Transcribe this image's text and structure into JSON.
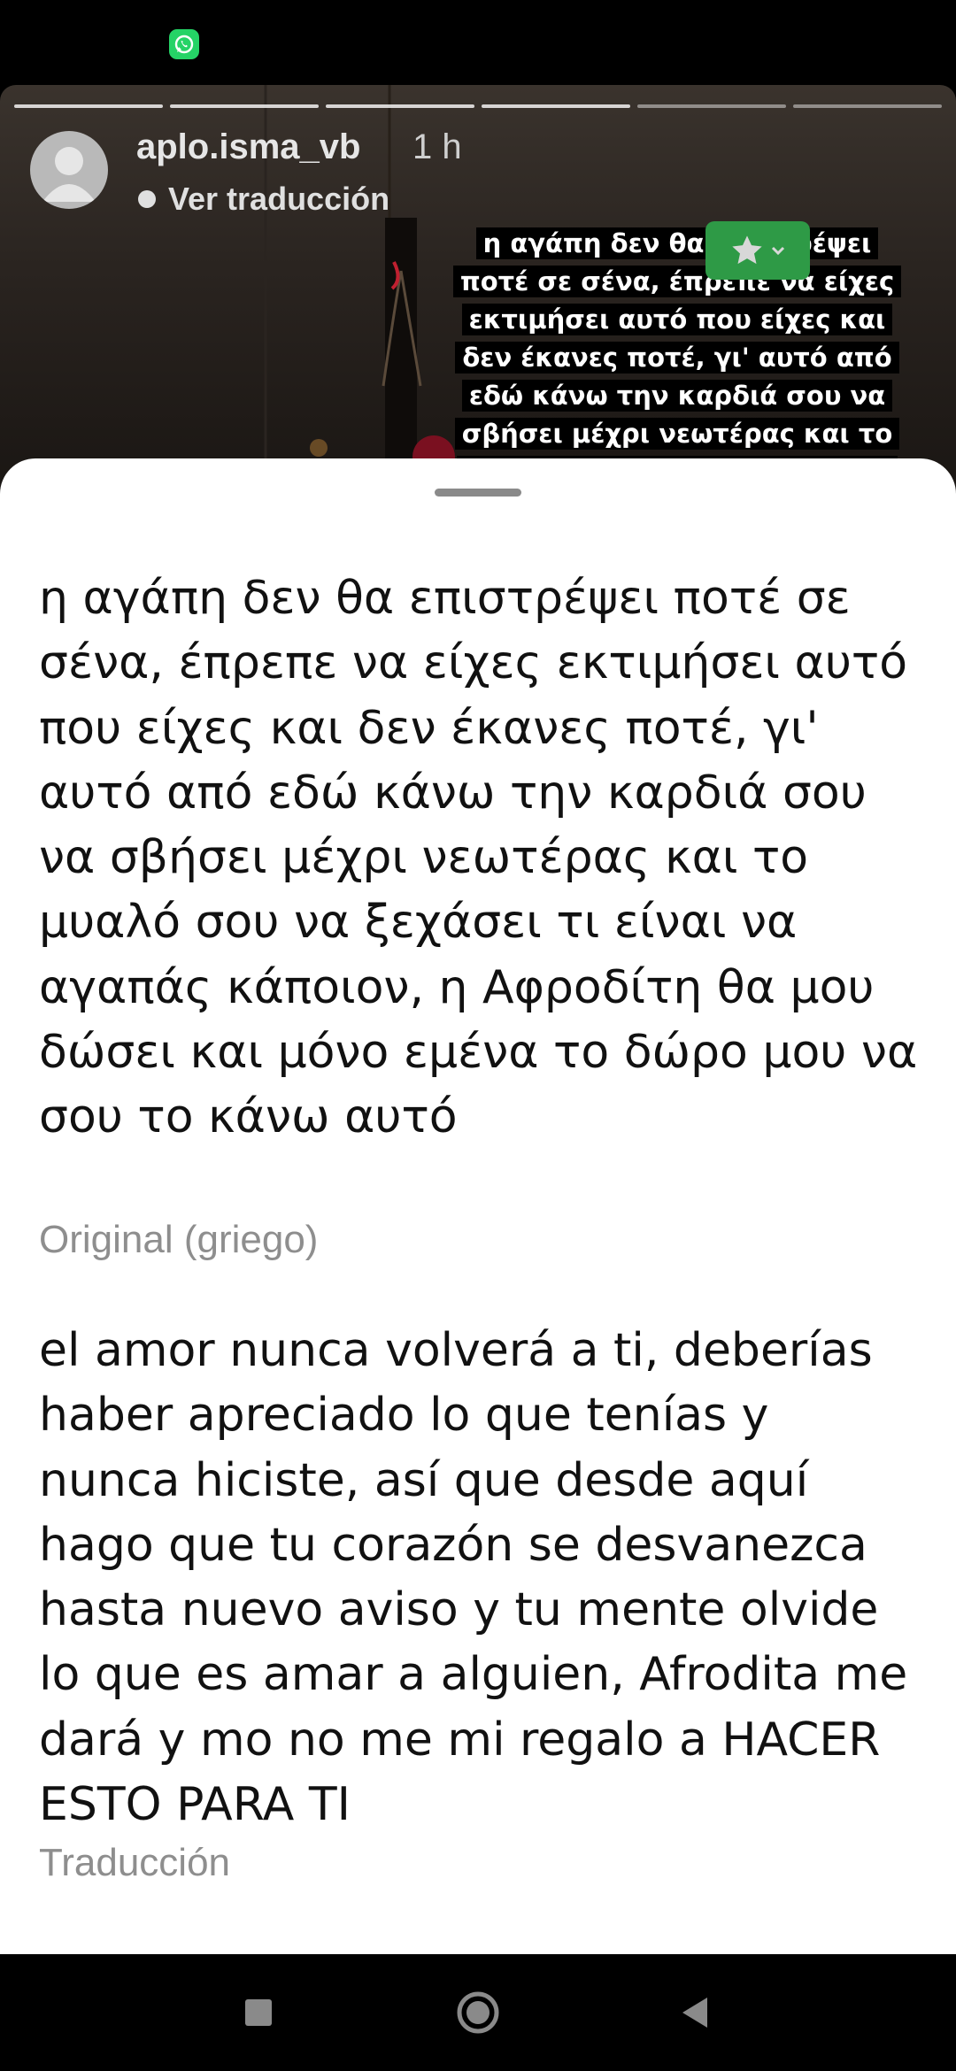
{
  "status_bar": {
    "notification_icon": "whatsapp-icon"
  },
  "story": {
    "username": "aplo.isma_vb",
    "time": "1 h",
    "translate_link": "Ver traducción",
    "text": "η αγάπη δεν θα επιστρέψει ποτέ σε σένα, έπρεπε να είχες εκτιμήσει αυτό που είχες και δεν έκανες ποτέ, γι' αυτό από εδώ κάνω την καρδιά σου να σβήσει μέχρι νεωτέρας και το μυαλό σου να ξεχάσει τι είναι να αγαπάς",
    "favorite_badge_icon": "star-icon",
    "favorite_color": "#2e9a46"
  },
  "sheet": {
    "original_text": "η αγάπη δεν θα επιστρέψει ποτέ σε σένα, έπρεπε να είχες εκτιμήσει αυτό που είχες και δεν έκανες ποτέ, γι' αυτό από εδώ κάνω την καρδιά σου να σβήσει μέχρι νεωτέρας και το μυαλό σου να ξεχάσει τι είναι να αγαπάς κάποιον, η Αφροδίτη θα μου δώσει και μόνο εμένα το δώρο μου να σου το κάνω αυτό",
    "original_label": "Original (griego)",
    "translated_text": "el amor nunca volverá a ti, deberías haber apreciado lo que tenías y nunca hiciste, así que desde aquí hago que tu corazón se desvanezca hasta nuevo aviso y tu mente olvide lo que es amar a alguien, Afrodita me dará y mo no me mi regalo a HACER ESTO PARA TI",
    "translated_label": "Traducción"
  },
  "nav_bar": {
    "recents_icon": "square-icon",
    "home_icon": "circle-icon",
    "back_icon": "triangle-back-icon"
  }
}
